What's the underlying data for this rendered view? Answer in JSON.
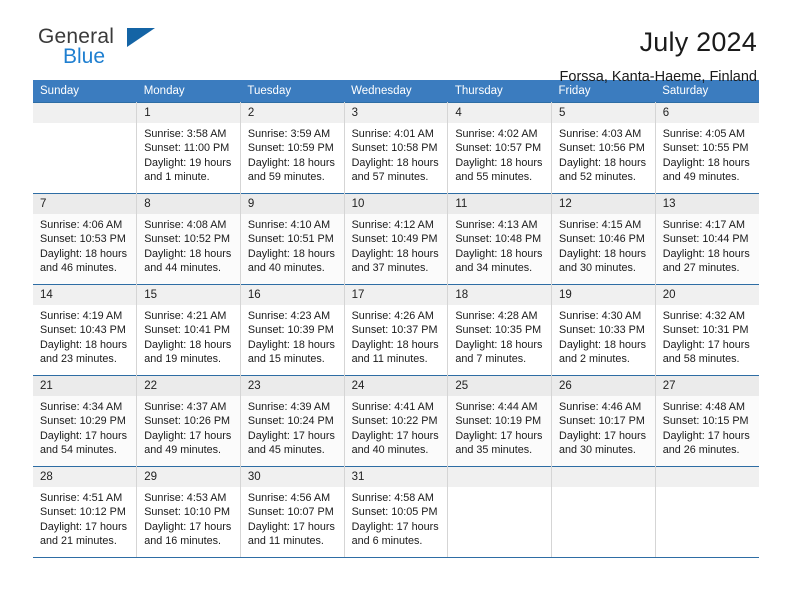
{
  "brand": {
    "line1": "General",
    "line2": "Blue",
    "triangle_color": "#1464a5",
    "blue_color": "#1f7fd0"
  },
  "header": {
    "month_title": "July 2024",
    "location": "Forssa, Kanta-Haeme, Finland"
  },
  "theme": {
    "header_bg": "#3b7cbf",
    "row_divider": "#2e6da4",
    "daynum_bg": "#f0f0f0"
  },
  "calendar": {
    "weekday_headers": [
      "Sunday",
      "Monday",
      "Tuesday",
      "Wednesday",
      "Thursday",
      "Friday",
      "Saturday"
    ],
    "weeks": [
      [
        {
          "day": "",
          "sunrise": "",
          "sunset": "",
          "daylight1": "",
          "daylight2": ""
        },
        {
          "day": "1",
          "sunrise": "Sunrise: 3:58 AM",
          "sunset": "Sunset: 11:00 PM",
          "daylight1": "Daylight: 19 hours",
          "daylight2": "and 1 minute."
        },
        {
          "day": "2",
          "sunrise": "Sunrise: 3:59 AM",
          "sunset": "Sunset: 10:59 PM",
          "daylight1": "Daylight: 18 hours",
          "daylight2": "and 59 minutes."
        },
        {
          "day": "3",
          "sunrise": "Sunrise: 4:01 AM",
          "sunset": "Sunset: 10:58 PM",
          "daylight1": "Daylight: 18 hours",
          "daylight2": "and 57 minutes."
        },
        {
          "day": "4",
          "sunrise": "Sunrise: 4:02 AM",
          "sunset": "Sunset: 10:57 PM",
          "daylight1": "Daylight: 18 hours",
          "daylight2": "and 55 minutes."
        },
        {
          "day": "5",
          "sunrise": "Sunrise: 4:03 AM",
          "sunset": "Sunset: 10:56 PM",
          "daylight1": "Daylight: 18 hours",
          "daylight2": "and 52 minutes."
        },
        {
          "day": "6",
          "sunrise": "Sunrise: 4:05 AM",
          "sunset": "Sunset: 10:55 PM",
          "daylight1": "Daylight: 18 hours",
          "daylight2": "and 49 minutes."
        }
      ],
      [
        {
          "day": "7",
          "sunrise": "Sunrise: 4:06 AM",
          "sunset": "Sunset: 10:53 PM",
          "daylight1": "Daylight: 18 hours",
          "daylight2": "and 46 minutes."
        },
        {
          "day": "8",
          "sunrise": "Sunrise: 4:08 AM",
          "sunset": "Sunset: 10:52 PM",
          "daylight1": "Daylight: 18 hours",
          "daylight2": "and 44 minutes."
        },
        {
          "day": "9",
          "sunrise": "Sunrise: 4:10 AM",
          "sunset": "Sunset: 10:51 PM",
          "daylight1": "Daylight: 18 hours",
          "daylight2": "and 40 minutes."
        },
        {
          "day": "10",
          "sunrise": "Sunrise: 4:12 AM",
          "sunset": "Sunset: 10:49 PM",
          "daylight1": "Daylight: 18 hours",
          "daylight2": "and 37 minutes."
        },
        {
          "day": "11",
          "sunrise": "Sunrise: 4:13 AM",
          "sunset": "Sunset: 10:48 PM",
          "daylight1": "Daylight: 18 hours",
          "daylight2": "and 34 minutes."
        },
        {
          "day": "12",
          "sunrise": "Sunrise: 4:15 AM",
          "sunset": "Sunset: 10:46 PM",
          "daylight1": "Daylight: 18 hours",
          "daylight2": "and 30 minutes."
        },
        {
          "day": "13",
          "sunrise": "Sunrise: 4:17 AM",
          "sunset": "Sunset: 10:44 PM",
          "daylight1": "Daylight: 18 hours",
          "daylight2": "and 27 minutes."
        }
      ],
      [
        {
          "day": "14",
          "sunrise": "Sunrise: 4:19 AM",
          "sunset": "Sunset: 10:43 PM",
          "daylight1": "Daylight: 18 hours",
          "daylight2": "and 23 minutes."
        },
        {
          "day": "15",
          "sunrise": "Sunrise: 4:21 AM",
          "sunset": "Sunset: 10:41 PM",
          "daylight1": "Daylight: 18 hours",
          "daylight2": "and 19 minutes."
        },
        {
          "day": "16",
          "sunrise": "Sunrise: 4:23 AM",
          "sunset": "Sunset: 10:39 PM",
          "daylight1": "Daylight: 18 hours",
          "daylight2": "and 15 minutes."
        },
        {
          "day": "17",
          "sunrise": "Sunrise: 4:26 AM",
          "sunset": "Sunset: 10:37 PM",
          "daylight1": "Daylight: 18 hours",
          "daylight2": "and 11 minutes."
        },
        {
          "day": "18",
          "sunrise": "Sunrise: 4:28 AM",
          "sunset": "Sunset: 10:35 PM",
          "daylight1": "Daylight: 18 hours",
          "daylight2": "and 7 minutes."
        },
        {
          "day": "19",
          "sunrise": "Sunrise: 4:30 AM",
          "sunset": "Sunset: 10:33 PM",
          "daylight1": "Daylight: 18 hours",
          "daylight2": "and 2 minutes."
        },
        {
          "day": "20",
          "sunrise": "Sunrise: 4:32 AM",
          "sunset": "Sunset: 10:31 PM",
          "daylight1": "Daylight: 17 hours",
          "daylight2": "and 58 minutes."
        }
      ],
      [
        {
          "day": "21",
          "sunrise": "Sunrise: 4:34 AM",
          "sunset": "Sunset: 10:29 PM",
          "daylight1": "Daylight: 17 hours",
          "daylight2": "and 54 minutes."
        },
        {
          "day": "22",
          "sunrise": "Sunrise: 4:37 AM",
          "sunset": "Sunset: 10:26 PM",
          "daylight1": "Daylight: 17 hours",
          "daylight2": "and 49 minutes."
        },
        {
          "day": "23",
          "sunrise": "Sunrise: 4:39 AM",
          "sunset": "Sunset: 10:24 PM",
          "daylight1": "Daylight: 17 hours",
          "daylight2": "and 45 minutes."
        },
        {
          "day": "24",
          "sunrise": "Sunrise: 4:41 AM",
          "sunset": "Sunset: 10:22 PM",
          "daylight1": "Daylight: 17 hours",
          "daylight2": "and 40 minutes."
        },
        {
          "day": "25",
          "sunrise": "Sunrise: 4:44 AM",
          "sunset": "Sunset: 10:19 PM",
          "daylight1": "Daylight: 17 hours",
          "daylight2": "and 35 minutes."
        },
        {
          "day": "26",
          "sunrise": "Sunrise: 4:46 AM",
          "sunset": "Sunset: 10:17 PM",
          "daylight1": "Daylight: 17 hours",
          "daylight2": "and 30 minutes."
        },
        {
          "day": "27",
          "sunrise": "Sunrise: 4:48 AM",
          "sunset": "Sunset: 10:15 PM",
          "daylight1": "Daylight: 17 hours",
          "daylight2": "and 26 minutes."
        }
      ],
      [
        {
          "day": "28",
          "sunrise": "Sunrise: 4:51 AM",
          "sunset": "Sunset: 10:12 PM",
          "daylight1": "Daylight: 17 hours",
          "daylight2": "and 21 minutes."
        },
        {
          "day": "29",
          "sunrise": "Sunrise: 4:53 AM",
          "sunset": "Sunset: 10:10 PM",
          "daylight1": "Daylight: 17 hours",
          "daylight2": "and 16 minutes."
        },
        {
          "day": "30",
          "sunrise": "Sunrise: 4:56 AM",
          "sunset": "Sunset: 10:07 PM",
          "daylight1": "Daylight: 17 hours",
          "daylight2": "and 11 minutes."
        },
        {
          "day": "31",
          "sunrise": "Sunrise: 4:58 AM",
          "sunset": "Sunset: 10:05 PM",
          "daylight1": "Daylight: 17 hours",
          "daylight2": "and 6 minutes."
        },
        {
          "day": "",
          "sunrise": "",
          "sunset": "",
          "daylight1": "",
          "daylight2": ""
        },
        {
          "day": "",
          "sunrise": "",
          "sunset": "",
          "daylight1": "",
          "daylight2": ""
        },
        {
          "day": "",
          "sunrise": "",
          "sunset": "",
          "daylight1": "",
          "daylight2": ""
        }
      ]
    ]
  }
}
